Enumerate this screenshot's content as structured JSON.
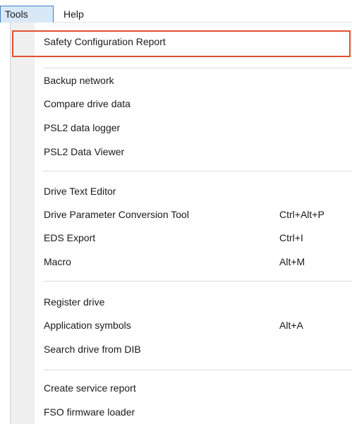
{
  "menubar": {
    "tools_label": "Tools",
    "help_label": "Help"
  },
  "menu": {
    "items": [
      {
        "label": "Safety Configuration Report",
        "shortcut": ""
      },
      {
        "label": "Backup network",
        "shortcut": ""
      },
      {
        "label": "Compare drive data",
        "shortcut": ""
      },
      {
        "label": "PSL2 data logger",
        "shortcut": ""
      },
      {
        "label": "PSL2 Data Viewer",
        "shortcut": ""
      },
      {
        "label": "Drive Text Editor",
        "shortcut": ""
      },
      {
        "label": "Drive Parameter Conversion Tool",
        "shortcut": "Ctrl+Alt+P"
      },
      {
        "label": "EDS Export",
        "shortcut": "Ctrl+I"
      },
      {
        "label": "Macro",
        "shortcut": "Alt+M"
      },
      {
        "label": "Register drive",
        "shortcut": ""
      },
      {
        "label": "Application symbols",
        "shortcut": "Alt+A"
      },
      {
        "label": "Search drive from DIB",
        "shortcut": ""
      },
      {
        "label": "Create service report",
        "shortcut": ""
      },
      {
        "label": "FSO firmware loader",
        "shortcut": ""
      }
    ]
  },
  "colors": {
    "highlight_border": "#e2502f",
    "active_menu_bg": "#d9e8f7",
    "active_menu_border": "#3d7fc4"
  }
}
